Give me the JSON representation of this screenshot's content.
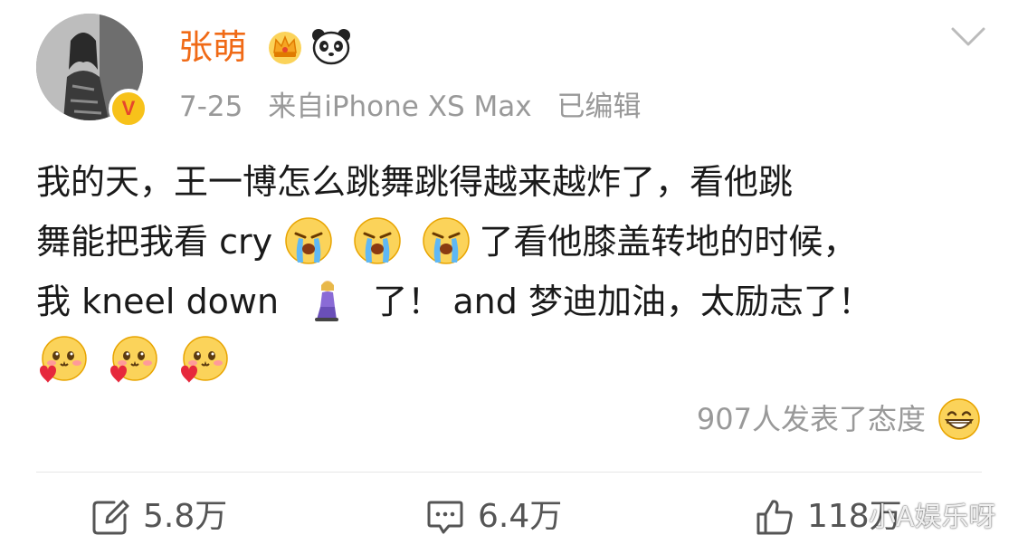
{
  "post": {
    "author_name": "张萌",
    "verified_badge": "V",
    "date": "7-25",
    "source": "来自iPhone XS Max",
    "edited": "已编辑",
    "text": {
      "line1": "我的天，王一博怎么跳舞跳得越来越炸了，看他跳",
      "line2a": "舞能把我看 cry",
      "line2b": "了看他膝盖转地的时候，",
      "line3a": "我 kneel down",
      "line3b": "了！  and 梦迪加油，太励志了！"
    },
    "emojis": {
      "cry": "crying-face-emoji",
      "kneel": "person-kneeling-emoji",
      "love": "love-heart-face-emoji"
    },
    "reactions_text": "907人发表了态度",
    "reactions_icon": "grinning-face-emoji"
  },
  "actions": {
    "repost_count": "5.8万",
    "comment_count": "6.4万",
    "like_count": "118万"
  },
  "watermark": "小A娱乐呀",
  "colors": {
    "author_name": "#f06a16",
    "meta": "#999999",
    "body": "#1a1a1a",
    "badge": "#f7c21a"
  }
}
